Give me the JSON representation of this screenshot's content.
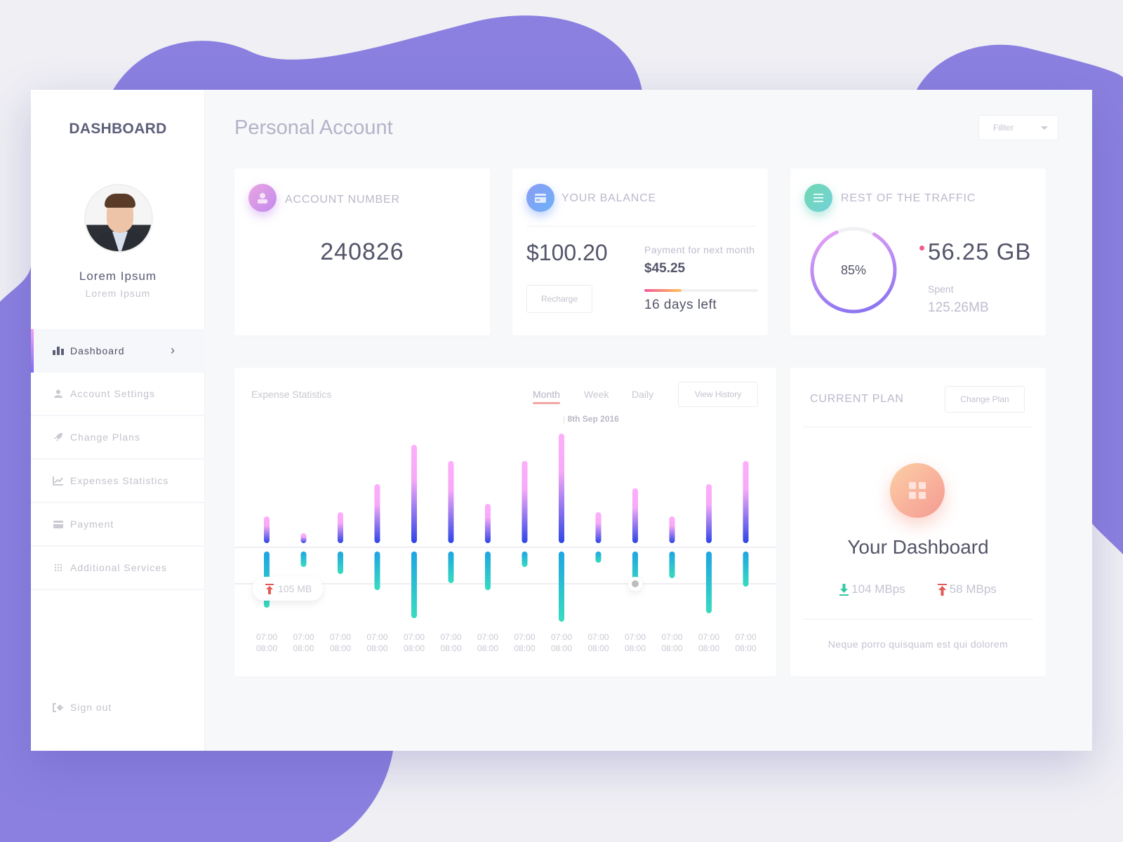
{
  "sidebar": {
    "brand": "DASHBOARD",
    "user_name": "Lorem Ipsum",
    "user_subtitle": "Lorem Ipsum",
    "items": [
      {
        "label": "Dashboard",
        "icon": "bar-chart-icon",
        "active": true
      },
      {
        "label": "Account Settings",
        "icon": "user-icon",
        "active": false
      },
      {
        "label": "Change Plans",
        "icon": "rocket-icon",
        "active": false
      },
      {
        "label": "Expenses Statistics",
        "icon": "line-chart-icon",
        "active": false
      },
      {
        "label": "Payment",
        "icon": "credit-card-icon",
        "active": false
      },
      {
        "label": "Additional Services",
        "icon": "grid-dots-icon",
        "active": false
      }
    ],
    "signout_label": "Sign out"
  },
  "header": {
    "title": "Personal Account",
    "filter_label": "Fillter"
  },
  "account_card": {
    "title": "ACCOUNT NUMBER",
    "value": "240826"
  },
  "balance_card": {
    "title": "YOUR BALANCE",
    "balance": "$100.20",
    "recharge_label": "Recharge",
    "next_payment_label": "Payment for next month",
    "next_payment_value": "$45.25",
    "days_left": "16 days left",
    "days_progress_fraction": 0.33
  },
  "traffic_card": {
    "title": "REST OF THE TRAFFIC",
    "percent_label": "85%",
    "percent_value": 85,
    "remaining": "56.25 GB",
    "spent_label": "Spent",
    "spent_value": "125.26MB"
  },
  "expense_stats": {
    "title": "Expense Statistics",
    "tabs": [
      {
        "label": "Month",
        "active": true
      },
      {
        "label": "Week",
        "active": false
      },
      {
        "label": "Daily",
        "active": false
      }
    ],
    "view_history_label": "View History",
    "marker_date": "8th Sep 2016",
    "tooltip_value": "105 MB"
  },
  "chart_data": {
    "type": "bar",
    "title": "Expense Statistics",
    "categories": [
      "07:00\n08:00",
      "07:00\n08:00",
      "07:00\n08:00",
      "07:00\n08:00",
      "07:00\n08:00",
      "07:00\n08:00",
      "07:00\n08:00",
      "07:00\n08:00",
      "07:00\n08:00",
      "07:00\n08:00",
      "07:00\n08:00",
      "07:00\n08:00",
      "07:00\n08:00",
      "07:00\n08:00"
    ],
    "tick_top": "07:00",
    "tick_bottom": "08:00",
    "series": [
      {
        "name": "upload",
        "values": [
          38,
          14,
          44,
          84,
          140,
          117,
          56,
          117,
          156,
          44,
          78,
          38,
          84,
          117
        ]
      },
      {
        "name": "download",
        "values": [
          -80,
          -22,
          -32,
          -55,
          -95,
          -45,
          -55,
          -22,
          -100,
          -16,
          -53,
          -38,
          -88,
          -50
        ]
      }
    ],
    "highlight_index": 10,
    "ylim": [
      -105,
      160
    ],
    "xlabel": "",
    "ylabel": "",
    "grid": false
  },
  "plan_card": {
    "title": "CURRENT PLAN",
    "change_label": "Change Plan",
    "plan_name": "Your Dashboard",
    "download_speed": "104 MBps",
    "upload_speed": "58 MBps",
    "footer_text": "Neque porro quisquam est qui dolorem"
  },
  "colors": {
    "accent_purple": "#8b80e0",
    "text_dark": "#535569",
    "text_muted": "#b9b9cc",
    "download_green": "#2fc9a3",
    "upload_red": "#e25a55"
  }
}
